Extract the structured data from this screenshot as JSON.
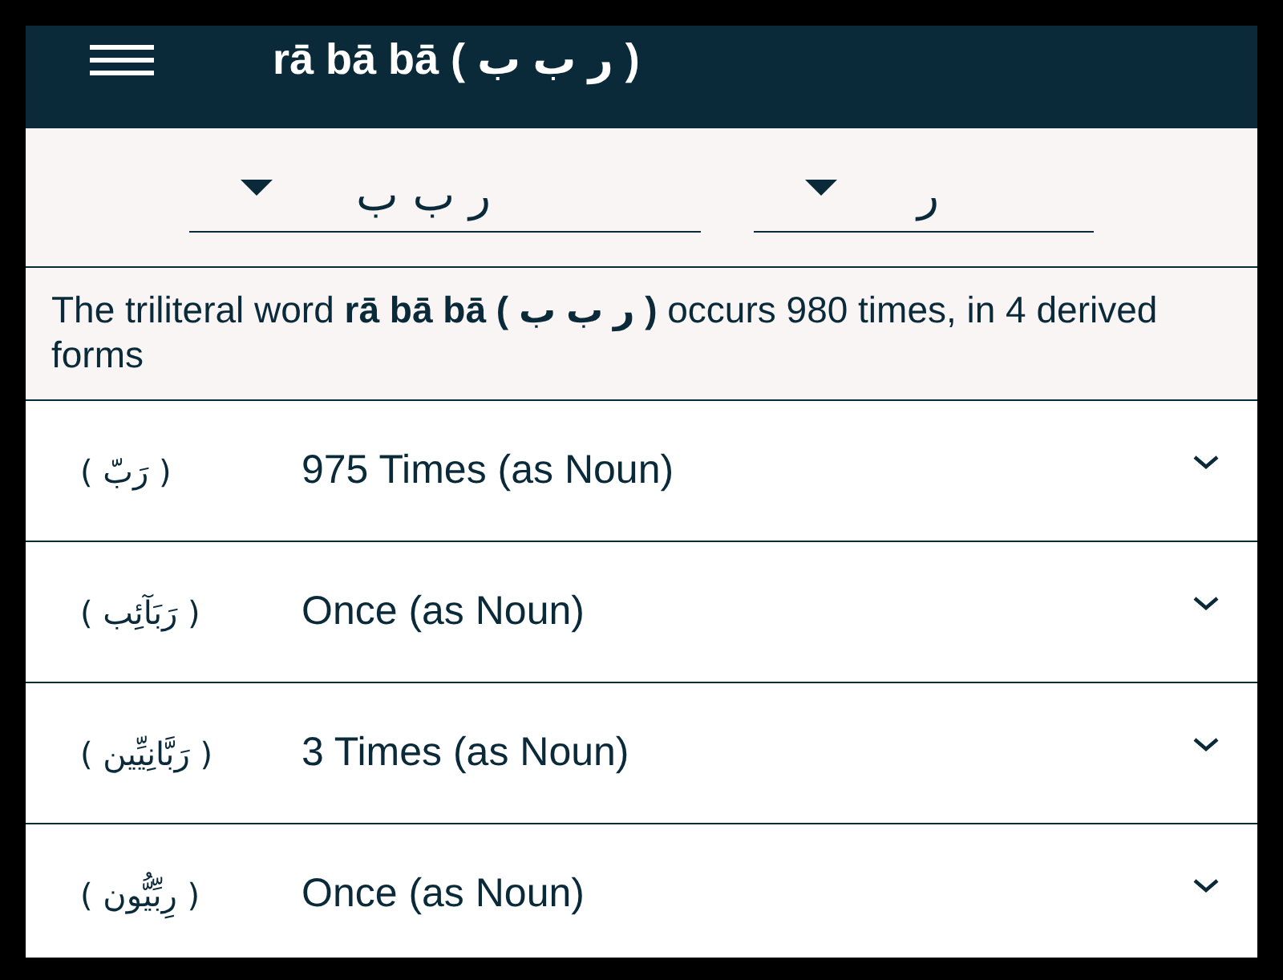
{
  "app_bar": {
    "title": "rā bā bā ( ر ب ب )"
  },
  "selectors": [
    {
      "value": "ر"
    },
    {
      "value": "ر ب ب"
    }
  ],
  "summary": "The triliteral word **rā bā bā ( ر ب ب )** occurs 980 times, in 4 derived forms",
  "forms": [
    {
      "arabic": "( رَبّ )",
      "count": "975 Times (as Noun)",
      "expanded": false
    },
    {
      "arabic": "( رَبَآئِب )",
      "count": "Once (as Noun)",
      "expanded": false
    },
    {
      "arabic": "( رَبَّانِيِّين )",
      "count": "3 Times (as Noun)",
      "expanded": false
    },
    {
      "arabic": "( رِبِّيُّون )",
      "count": "Once (as Noun)",
      "expanded": false
    }
  ]
}
